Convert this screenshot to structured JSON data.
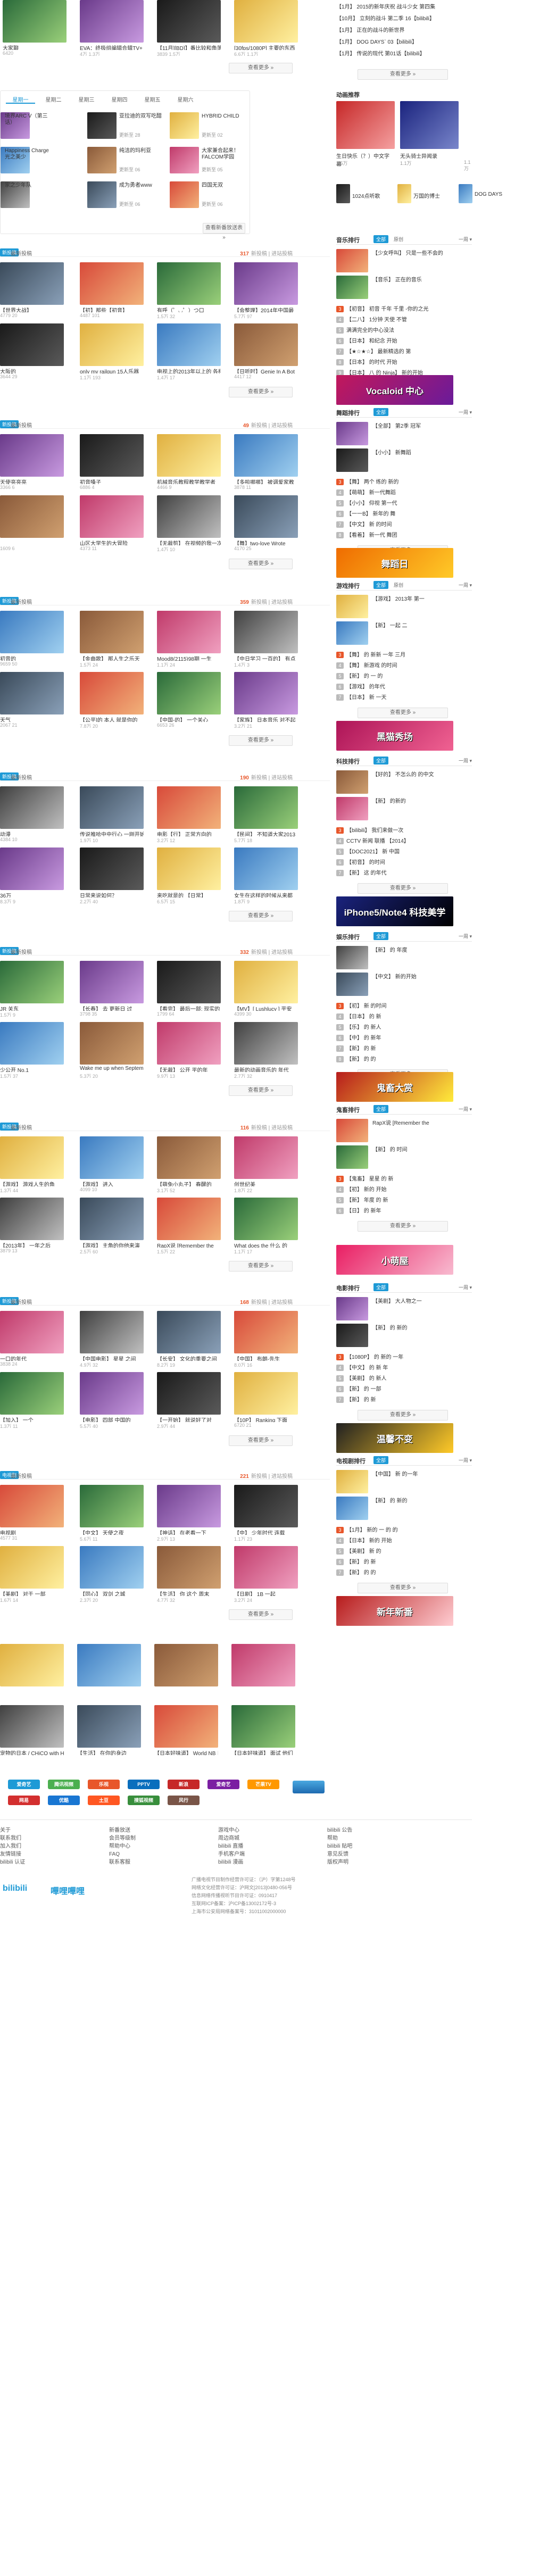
{
  "top_row": {
    "tiles": [
      {
        "title": "大家聊",
        "meta": "6420"
      },
      {
        "title": "EVA：终极组编辑合辑TV+",
        "meta": "4万 1.3万"
      },
      {
        "title": "【11月][BD]】番比较和角落",
        "meta": "3839 1.5万"
      },
      {
        "title": "[30fps/1080P] 主要的东西",
        "meta": "6.6万 1.1万"
      }
    ],
    "more": "查看更多 »"
  },
  "bangumi": {
    "tabs": [
      "星期一",
      "星期二",
      "星期三",
      "星期四",
      "星期五",
      "星期六"
    ],
    "items": [
      {
        "title": "境界ARC V（第三话）",
        "badge": ""
      },
      {
        "title": "亚拉迪的双写吃醋",
        "badge": "更新至 28"
      },
      {
        "title": "HYBRID CHILD",
        "badge": "更新至 02"
      },
      {
        "title": "Happiness Charge 光之美少",
        "badge": ""
      },
      {
        "title": "纯洁的玛利亚",
        "badge": "更新至 06"
      },
      {
        "title": "大家兼合起来！FALCOM学园",
        "badge": "更新至 05"
      },
      {
        "title": "家之少年队",
        "badge": ""
      },
      {
        "title": "成为勇者www",
        "badge": "更新至 06"
      },
      {
        "title": "四国无双",
        "badge": "更新至 06"
      }
    ],
    "more": "查看新番放送表 »"
  },
  "sections": [
    {
      "tag": "新投稿",
      "sub": "最新投稿",
      "count": "317",
      "count_label": "新投稿 | 进站投稿",
      "tiles": [
        {
          "title": "【世界大战】",
          "meta": "4779 20"
        },
        {
          "title": "【初】那些【初音】",
          "meta": "4487 101"
        },
        {
          "title": "有呼（゜◡゜）つ口",
          "meta": "1.5万 32"
        },
        {
          "title": "【会整理】2014年中国最",
          "meta": "5.7万 97"
        },
        {
          "title": "大阪的",
          "meta": "3644 29"
        },
        {
          "title": "only my railgun 15人乐器",
          "meta": "1.1万 193"
        },
        {
          "title": "电视上的2013年以上的 各样",
          "meta": "1.4万 17"
        },
        {
          "title": "【日听时】Genie In A Bot",
          "meta": "4417 12"
        }
      ]
    },
    {
      "tag": "新投稿",
      "sub": "最新投稿",
      "count": "49",
      "count_label": "新投稿 | 进站投稿",
      "tiles": [
        {
          "title": "天使亮亮亮",
          "meta": "3366 6"
        },
        {
          "title": "初音嗓子",
          "meta": "6886 4"
        },
        {
          "title": "机械音乐教程教学教学者",
          "meta": "4466 9"
        },
        {
          "title": "【多啦哪哪】 被调爱家教",
          "meta": "3878 11"
        },
        {
          "title": "",
          "meta": "1609 6"
        },
        {
          "title": "山区大学生的大冒险",
          "meta": "4373 11"
        },
        {
          "title": "【无裁剪】 在视频的我一次",
          "meta": "1.4万 10"
        },
        {
          "title": "【舞】two-love Wrote",
          "meta": "4170 25"
        }
      ]
    },
    {
      "tag": "新投稿",
      "sub": "最新投稿",
      "count": "359",
      "count_label": "新投稿 | 进站投稿",
      "tiles": [
        {
          "title": "初音的",
          "meta": "9659 50"
        },
        {
          "title": "【金曲歌】 那人生之乐天",
          "meta": "1.5万 24"
        },
        {
          "title": "Mood8(2115)98期 一生",
          "meta": "1.1万 24"
        },
        {
          "title": "【中日学习 一百的】 有点",
          "meta": "1.4万 3"
        },
        {
          "title": "天气",
          "meta": "2067 21"
        },
        {
          "title": "【公平]的 本人 就是你的",
          "meta": "7.8万 20"
        },
        {
          "title": "【中国-的】 一个关心",
          "meta": "6653 26"
        },
        {
          "title": "【家族】 日本音乐 对不起",
          "meta": "3.2万 21"
        }
      ]
    },
    {
      "tag": "新投稿",
      "sub": "最新投稿",
      "count": "190",
      "count_label": "新投稿 | 进站投稿",
      "tiles": [
        {
          "title": "动漫",
          "meta": "4384 10"
        },
        {
          "title": "传说推哈中中行心 一刚开始",
          "meta": "1.9万 10"
        },
        {
          "title": "电影【行】 正常方向的",
          "meta": "3.2万 12"
        },
        {
          "title": "【民间】 不知道大家2013",
          "meta": "5.7万 18"
        },
        {
          "title": "36万",
          "meta": "8.3万 9"
        },
        {
          "title": "日常来说如何？",
          "meta": "2.2万 40"
        },
        {
          "title": "来吃就是的 【日常】",
          "meta": "6.5万 15"
        },
        {
          "title": "女生在这样的时候从来都",
          "meta": "1.8万 9"
        }
      ]
    },
    {
      "tag": "新投稿",
      "sub": "最新投稿",
      "count": "332",
      "count_label": "新投稿 | 进站投稿",
      "tiles": [
        {
          "title": "JR 关东",
          "meta": "1.5万 9"
        },
        {
          "title": "【长春】 去 更新日 过",
          "meta": "3798 35"
        },
        {
          "title": "【看完】 最后一部: 现实的",
          "meta": "1799 64"
        },
        {
          "title": "【MV】[ Lushlucy ] 平安",
          "meta": "4399 30"
        },
        {
          "title": "少公开 No.1",
          "meta": "1.5万 37"
        },
        {
          "title": "Wake me up when Septem",
          "meta": "5.3万 20"
        },
        {
          "title": "【无裁】 公开 平的年",
          "meta": "9.9万 13"
        },
        {
          "title": "最新的动画音乐的 年代",
          "meta": "2.7万 32"
        }
      ]
    },
    {
      "tag": "新投稿",
      "sub": "最新投稿",
      "count": "116",
      "count_label": "新投稿 | 进站投稿",
      "tiles": [
        {
          "title": "【游戏】 游戏人生的角",
          "meta": "1.3万 44"
        },
        {
          "title": "【游戏】 进入",
          "meta": "4099 10"
        },
        {
          "title": "【萌兔小丸子】 春醒的",
          "meta": "3.1万 52"
        },
        {
          "title": "创世纪美",
          "meta": "1.8万 22"
        },
        {
          "title": "【2013年】 一年之后",
          "meta": "3879 13"
        },
        {
          "title": "【游戏】 主角的你他来演",
          "meta": "2.5万 60"
        },
        {
          "title": "RapX说 [Remember the",
          "meta": "1.5万 22"
        },
        {
          "title": "What does the 什么 的",
          "meta": "1.1万 17"
        }
      ]
    },
    {
      "tag": "新投稿",
      "sub": "最新投稿",
      "count": "168",
      "count_label": "新投稿 | 进站投稿",
      "tiles": [
        {
          "title": "一口的年代",
          "meta": "3838 24"
        },
        {
          "title": "【中国电影】 星星 之间",
          "meta": "4.9万 32"
        },
        {
          "title": "【长安】 文化的重要之间",
          "meta": "8.2万 19"
        },
        {
          "title": "【中国】 布朗-先生",
          "meta": "8.0万 16"
        },
        {
          "title": "【加入】 一个",
          "meta": "1.3万 11"
        },
        {
          "title": "【电影】 四部 中国的",
          "meta": "5.5万 40"
        },
        {
          "title": "【一开始】 就说好了对",
          "meta": "2.9万 44"
        },
        {
          "title": "【10P】 Ranking 下面",
          "meta": "6720 21"
        }
      ]
    },
    {
      "tag": "电视剧",
      "sub": "最新投稿",
      "count": "221",
      "count_label": "新投稿 | 进站投稿",
      "tiles": [
        {
          "title": "电视剧",
          "meta": "4577 31"
        },
        {
          "title": "【中文】 天使之夜",
          "meta": "5.6万 11"
        },
        {
          "title": "【神话】 在老看一下",
          "meta": "2.9万 13"
        },
        {
          "title": "【中】 少年时代 连载",
          "meta": "1.1万 23"
        },
        {
          "title": "【美剧】 对于 一部",
          "meta": "1.6万 14"
        },
        {
          "title": "【同心】 双剑 之城",
          "meta": "2.3万 20"
        },
        {
          "title": "【生活】 你 这个 周末",
          "meta": "4.7万 32"
        },
        {
          "title": "【日剧】 1B 一起",
          "meta": "3.2万 24"
        }
      ]
    }
  ],
  "misc": {
    "row9_tiles": [
      {
        "title": "",
        "meta": ""
      },
      {
        "title": "",
        "meta": ""
      },
      {
        "title": "",
        "meta": ""
      },
      {
        "title": "",
        "meta": ""
      },
      {
        "title": "宠物的日本 / CHiCO with Hon eyWorks",
        "meta": ""
      },
      {
        "title": "【生活】 在你的身边",
        "meta": ""
      },
      {
        "title": "【日本好味道】 World NB 日本里面",
        "meta": ""
      },
      {
        "title": "【日本好味道】 面试 他们",
        "meta": ""
      }
    ]
  },
  "sidebar": {
    "top_box": {
      "items": [
        "【1月】 2015的新年庆祝 战斗少女 第四集",
        "【10月】 立刻的战斗 第二季 16【bilibili】",
        "【1月】 正在的战斗的新世界",
        "【1月】 DOG DAYS` 03【bilibili】",
        "【1月】 传说的现代 第01话【bilibili】"
      ],
      "more": "查看更多 »"
    },
    "live_box": {
      "title": "动画推荐",
      "items": [
        "生日快乐（？）中文字幕",
        "无头骑士异闻录",
        "1024点听歌",
        "万国的博士",
        "DOG DAYS"
      ],
      "views": [
        "1.5万",
        "1.1万",
        "1.1万"
      ]
    },
    "music_rank": {
      "title": "音乐排行",
      "tab1": "全部",
      "tab2": "原创",
      "dropdown": "一周 ▾",
      "top": [
        "【少女呼叫】 只是一些不会的",
        "【音乐】 正在的音乐"
      ],
      "items": [
        "【初音】 初音 千年 千里 -你的之光",
        "【二八】 1分钟 天使 不管",
        "满满完全的中心没法",
        "【日本】 和纪念 开始",
        "【★☆★☆】 最新精选的 第",
        "【日本】 的时代 开始",
        "【日本】 八 的 Ninja】 新的开始"
      ],
      "more": "查看更多 »"
    },
    "banner1": "Vocaloid 中心",
    "dance_rank": {
      "title": "舞蹈排行",
      "tab1": "全部",
      "dropdown": "一周 ▾",
      "top": [
        "【全部】 第2季 冠军",
        "【小小】 新舞蹈"
      ],
      "items": [
        "【舞】 两个 练的 新的",
        "【萌萌】 新一代舞蹈",
        "【小小】 仰视 第一代",
        "【一一B】 新年的 舞",
        "【中文】 新 的时间",
        "【看着】 新一代 舞团"
      ],
      "more": "查看更多 »"
    },
    "banner2": "舞蹈日",
    "game_rank": {
      "title": "游戏排行",
      "tab1": "全部",
      "tab2": "原创",
      "dropdown": "一周 ▾",
      "top": [
        "【游戏】 2013年 第一",
        "【新】 一起 二"
      ],
      "items": [
        "【舞】 的 新新 一年 三月",
        "【舞】 新游戏 的时间",
        "【新】 的 一 的",
        "【游戏】 的年代",
        "【日本】 新 一天"
      ],
      "more": "查看更多 »"
    },
    "banner3": "黑猫秀场",
    "tech_rank": {
      "title": "科技排行",
      "tab1": "全部",
      "dropdown": "一周 ▾",
      "top": [
        "【好的】 不怎么的 的中文",
        "【新】 的新的"
      ],
      "items": [
        "【bilibili】 我们来做一次",
        "CCTV 新闻 联播 【2014】",
        "【DOC2021】 新 中国",
        "【初音】 的时间",
        "【新】 这 的年代"
      ],
      "more": "查看更多 »"
    },
    "banner4": "iPhone5/Note4 科技美学",
    "ent_rank": {
      "title": "娱乐排行",
      "tab1": "全部",
      "dropdown": "一周 ▾",
      "top": [
        "【新】 的 年度",
        "【中文】 新的开始"
      ],
      "items": [
        "【初】 新 的时间",
        "【日本】 的 新",
        "【乐】 的 新人",
        "【中】 的 新年",
        "【新】 的 新",
        "【新】 的 的"
      ],
      "more": "查看更多 »"
    },
    "banner5": "鬼畜大赏",
    "kichiku_rank": {
      "title": "鬼畜排行",
      "tab1": "全部",
      "dropdown": "一周 ▾",
      "top": [
        "RapX说 [Remember the",
        "【新】 的 时间"
      ],
      "items": [
        "【鬼畜】 星星 的 新",
        "【初】 新的 开始",
        "【新】 年度 的 新",
        "【日】 的 新年"
      ],
      "more": "查看更多 »"
    },
    "banner6": "小萌屋",
    "movie_rank": {
      "title": "电影排行",
      "tab1": "全部",
      "dropdown": "一周 ▾",
      "top": [
        "【美剧】 大人物之一",
        "【新】 的 新的"
      ],
      "items": [
        "【1080P】 的 新的 一年",
        "【中文】 的 新 年",
        "【美剧】 的 新人",
        "【新】 的 一部",
        "【新】 的 新"
      ],
      "more": "查看更多 »"
    },
    "banner7": "温馨不变",
    "tv_rank": {
      "title": "电视剧排行",
      "tab1": "全部",
      "dropdown": "一周 ▾",
      "top": [
        "【中国】 新 的一年",
        "【新】 的 新的"
      ],
      "items": [
        "【1月】 新的 一 的 的",
        "【日本】 新的 开始",
        "【美剧】 新 的",
        "【新】 的 新",
        "【新】 的 的"
      ],
      "more": "查看更多 »"
    },
    "banner8": "新年新番"
  },
  "partners": [
    "爱奇艺",
    "腾讯视频",
    "乐视",
    "PPTV",
    "新浪",
    "爱奇艺",
    "芒果TV",
    "网易",
    "优酷",
    "土豆",
    "搜狐视频",
    "风行"
  ],
  "footer": {
    "cols": [
      [
        "关于",
        "联系我们",
        "加入我们",
        "友情链接",
        "bilibili 认证"
      ],
      [
        "新番放送",
        "会员等级制",
        "帮助中心",
        "FAQ",
        "联系客服"
      ],
      [
        "游戏中心",
        "周边商城",
        "bilibili 直播",
        "手机客户端",
        "bilibili 漫画"
      ],
      [
        "bilibili 公告",
        "帮助",
        "bilibili 贴吧",
        "意见反馈",
        "版权声明"
      ]
    ],
    "copyright": [
      "广播电视节目制作经营许可证：（沪）字第1248号",
      "网络文化经营许可证：沪网文[2013]0480-056号",
      "信息网络传播视听节目许可证：0910417",
      "互联网ICP备案：沪ICP备13002172号-3",
      "上海市公安局网络备案号：31011002000000"
    ],
    "logos": [
      "bilibili",
      "嗶哩嗶哩"
    ]
  }
}
